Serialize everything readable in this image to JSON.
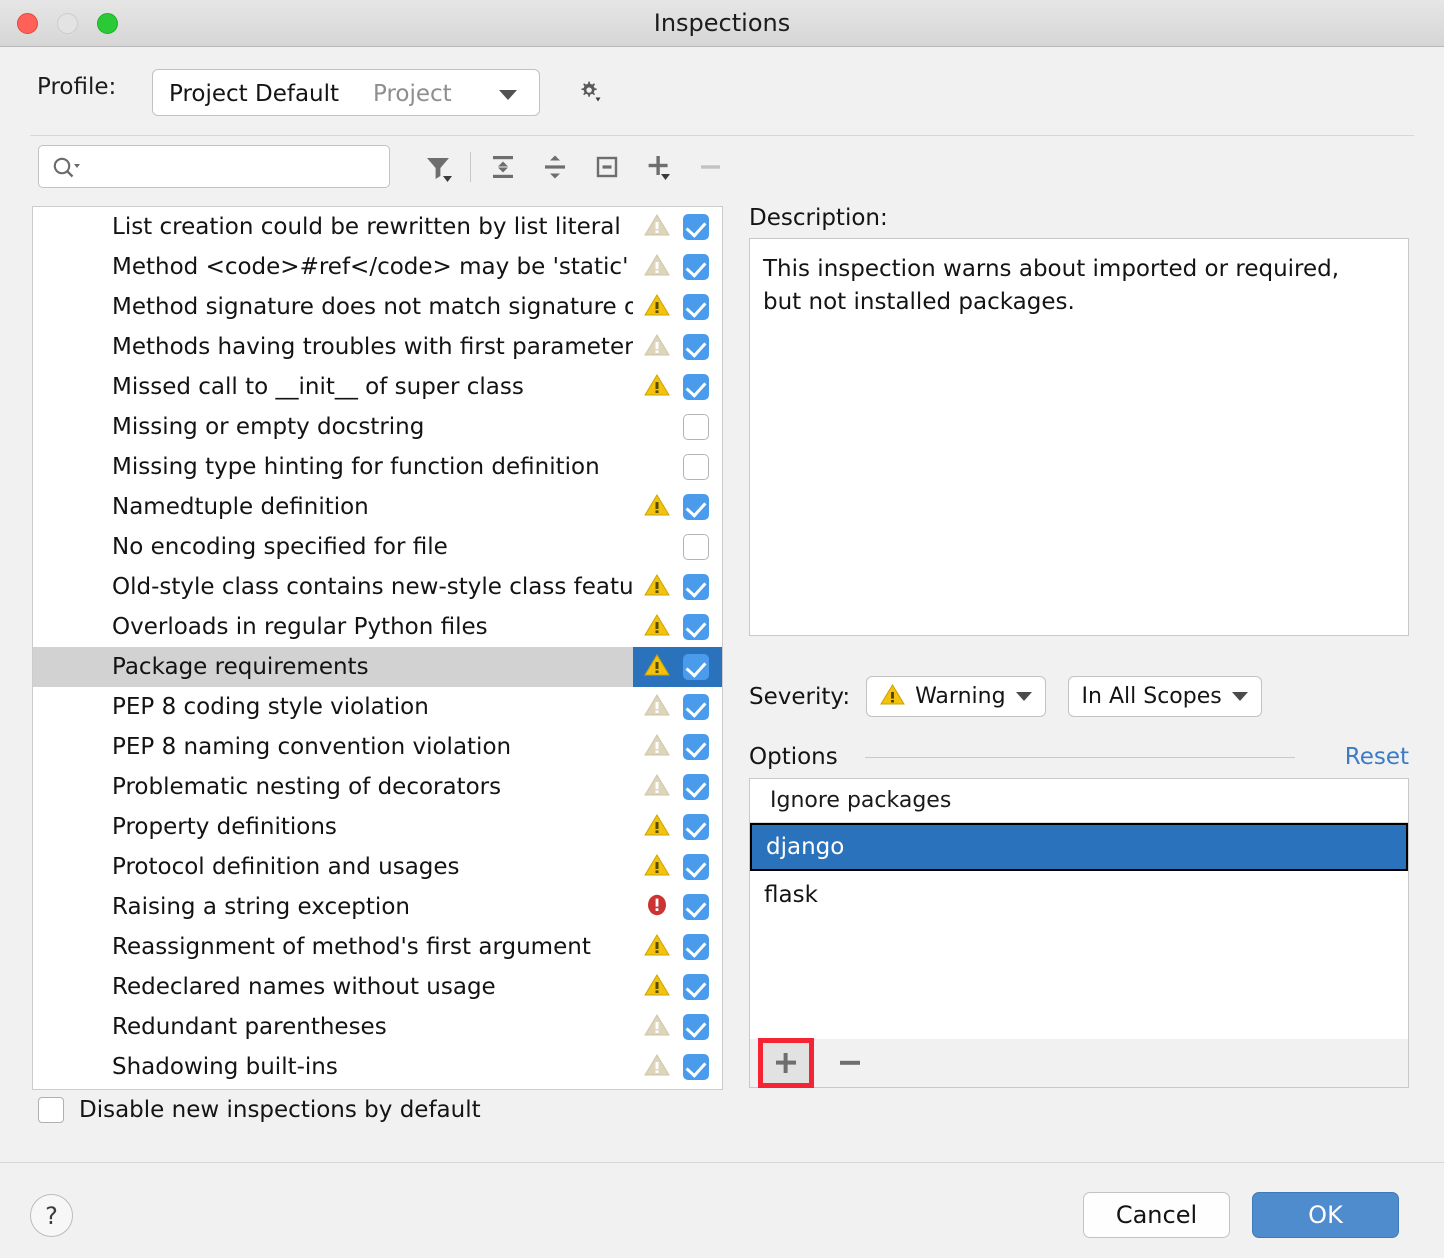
{
  "window": {
    "title": "Inspections"
  },
  "traffic_lights": [
    {
      "name": "close",
      "color": "#ff6159"
    },
    {
      "name": "minimize",
      "color": "#e3e3e3"
    },
    {
      "name": "zoom",
      "color": "#2ac937"
    }
  ],
  "profile": {
    "label": "Profile:",
    "value": "Project Default",
    "scope": "Project",
    "gear_tooltip": "Show Scheme Actions"
  },
  "search": {
    "value": "",
    "placeholder": ""
  },
  "toolbar": [
    {
      "name": "filter-icon",
      "label": "Filter"
    },
    {
      "name": "expand-all-icon",
      "label": "Expand All"
    },
    {
      "name": "collapse-all-icon",
      "label": "Collapse All"
    },
    {
      "name": "reset-to-empty-icon",
      "label": "Reset To Empty"
    },
    {
      "name": "add-icon",
      "label": "Add Scope"
    },
    {
      "name": "remove-icon",
      "label": "Remove Scope"
    }
  ],
  "inspections": [
    {
      "label": "List creation could be rewritten by list literal",
      "severity": "warning-weak",
      "checked": true,
      "selected": false
    },
    {
      "label": "Method <code>#ref</code> may be 'static'",
      "severity": "warning-weak",
      "checked": true,
      "selected": false
    },
    {
      "label": "Method signature does not match signature of overridden method",
      "severity": "warning",
      "checked": true,
      "selected": false
    },
    {
      "label": "Methods having troubles with first parameter",
      "severity": "warning-weak",
      "checked": true,
      "selected": false
    },
    {
      "label": "Missed call to __init__ of super class",
      "severity": "warning",
      "checked": true,
      "selected": false
    },
    {
      "label": "Missing or empty docstring",
      "severity": "none",
      "checked": false,
      "selected": false
    },
    {
      "label": "Missing type hinting for function definition",
      "severity": "none",
      "checked": false,
      "selected": false
    },
    {
      "label": "Namedtuple definition",
      "severity": "warning",
      "checked": true,
      "selected": false
    },
    {
      "label": "No encoding specified for file",
      "severity": "none",
      "checked": false,
      "selected": false
    },
    {
      "label": "Old-style class contains new-style class features",
      "severity": "warning",
      "checked": true,
      "selected": false
    },
    {
      "label": "Overloads in regular Python files",
      "severity": "warning",
      "checked": true,
      "selected": false
    },
    {
      "label": "Package requirements",
      "severity": "warning",
      "checked": true,
      "selected": true
    },
    {
      "label": "PEP 8 coding style violation",
      "severity": "warning-weak",
      "checked": true,
      "selected": false
    },
    {
      "label": "PEP 8 naming convention violation",
      "severity": "warning-weak",
      "checked": true,
      "selected": false
    },
    {
      "label": "Problematic nesting of decorators",
      "severity": "warning-weak",
      "checked": true,
      "selected": false
    },
    {
      "label": "Property definitions",
      "severity": "warning",
      "checked": true,
      "selected": false
    },
    {
      "label": "Protocol definition and usages",
      "severity": "warning",
      "checked": true,
      "selected": false
    },
    {
      "label": "Raising a string exception",
      "severity": "error",
      "checked": true,
      "selected": false
    },
    {
      "label": "Reassignment of method's first argument",
      "severity": "warning",
      "checked": true,
      "selected": false
    },
    {
      "label": "Redeclared names without usage",
      "severity": "warning",
      "checked": true,
      "selected": false
    },
    {
      "label": "Redundant parentheses",
      "severity": "warning-weak",
      "checked": true,
      "selected": false
    },
    {
      "label": "Shadowing built-ins",
      "severity": "warning-weak",
      "checked": true,
      "selected": false
    }
  ],
  "disable_new": {
    "label": "Disable new inspections by default",
    "checked": false
  },
  "description": {
    "label": "Description:",
    "text": "This inspection warns about imported or required, but not installed packages."
  },
  "severity": {
    "label": "Severity:",
    "value": "Warning",
    "scope_value": "In All Scopes"
  },
  "options": {
    "title": "Options",
    "reset_label": "Reset",
    "column_header": "Ignore packages",
    "items": [
      {
        "value": "django",
        "selected": true
      },
      {
        "value": "flask",
        "selected": false
      }
    ],
    "add_label": "+",
    "remove_label": "–"
  },
  "footer": {
    "help_label": "?",
    "cancel_label": "Cancel",
    "ok_label": "OK"
  },
  "colors": {
    "selection_blue": "#2b72bd",
    "checkbox_blue": "#4a9bec",
    "warning_yellow": "#f2c20c",
    "warning_weak": "#d9d0b4",
    "error_red": "#cc3333",
    "link_blue": "#3b7cc4",
    "highlight_red": "#f42434",
    "ok_button_blue": "#4e8ccd"
  }
}
